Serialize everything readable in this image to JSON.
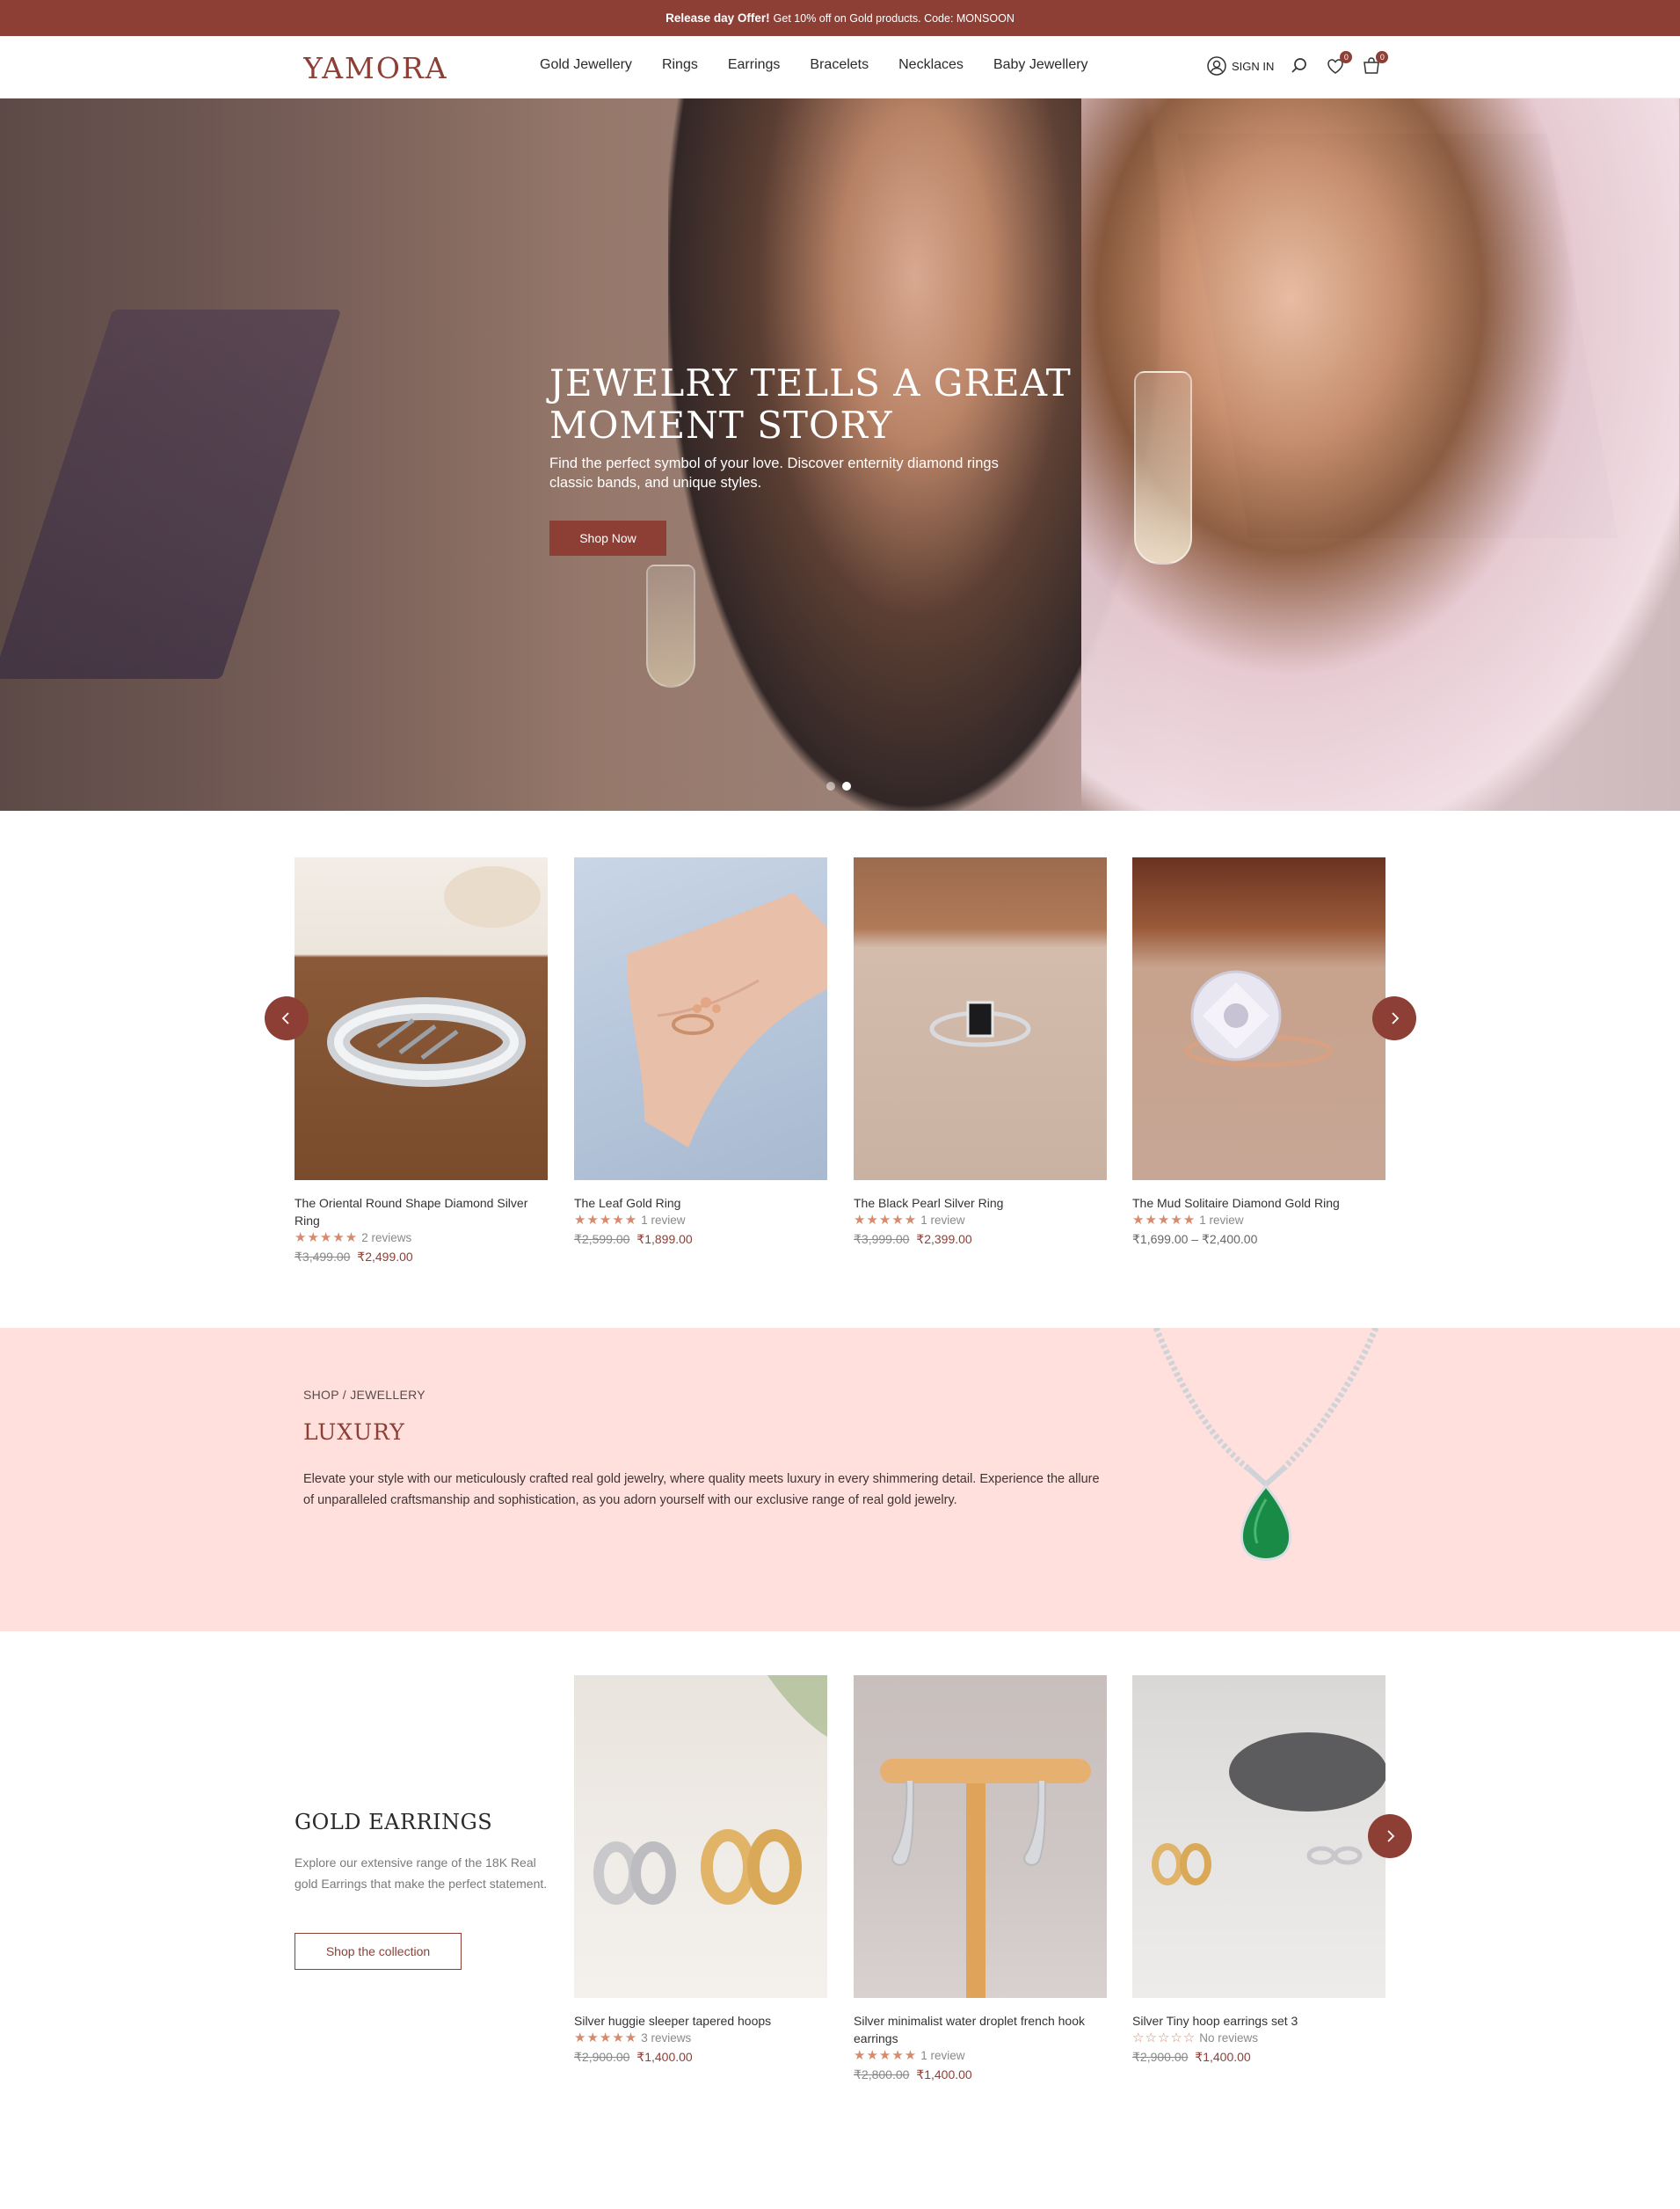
{
  "announcement": {
    "title": "Release day Offer!",
    "text": "Get 10% off on Gold products. Code: MONSOON"
  },
  "header": {
    "logo": "YAMORA",
    "nav": [
      "Gold Jewellery",
      "Rings",
      "Earrings",
      "Bracelets",
      "Necklaces",
      "Baby Jewellery"
    ],
    "sign_in": "SIGN IN",
    "wishlist_count": "0",
    "cart_count": "0"
  },
  "hero": {
    "title": "JEWELRY TELLS A GREAT MOMENT STORY",
    "subtitle": "Find the perfect symbol of your love. Discover enternity diamond rings classic bands, and unique styles.",
    "button": "Shop Now",
    "slides": 2,
    "active_slide": 2
  },
  "rings": [
    {
      "name": "The Oriental Round Shape Diamond Silver Ring",
      "stars": "★★★★★",
      "reviews": "2 reviews",
      "old_price": "₹3,499.00",
      "price": "₹2,499.00"
    },
    {
      "name": "The Leaf Gold Ring",
      "stars": "★★★★★",
      "reviews": "1 review",
      "old_price": "₹2,599.00",
      "price": "₹1,899.00"
    },
    {
      "name": "The Black Pearl Silver Ring",
      "stars": "★★★★★",
      "reviews": "1 review",
      "old_price": "₹3,999.00",
      "price": "₹2,399.00"
    },
    {
      "name": "The Mud Solitaire Diamond Gold Ring",
      "stars": "★★★★★",
      "reviews": "1 review",
      "price_range": "₹1,699.00 – ₹2,400.00"
    }
  ],
  "luxury": {
    "breadcrumb": "SHOP / JEWELLERY",
    "title": "LUXURY",
    "text": "Elevate your style with our meticulously crafted real gold jewelry, where quality meets luxury in every shimmering detail. Experience the allure of unparalleled craftsmanship and sophistication, as you adorn yourself with our exclusive range of real gold jewelry."
  },
  "earrings_section": {
    "title": "GOLD EARRINGS",
    "text": "Explore our extensive range of the 18K Real gold Earrings that make the perfect statement.",
    "button": "Shop the collection"
  },
  "earrings": [
    {
      "name": "Silver huggie sleeper tapered hoops",
      "stars": "★★★★★",
      "reviews": "3 reviews",
      "old_price": "₹2,900.00",
      "price": "₹1,400.00"
    },
    {
      "name": "Silver minimalist water droplet french hook earrings",
      "stars": "★★★★★",
      "reviews": "1 review",
      "old_price": "₹2,800.00",
      "price": "₹1,400.00"
    },
    {
      "name": "Silver Tiny hoop earrings set 3",
      "stars": "☆☆☆☆☆",
      "reviews": "No reviews",
      "old_price": "₹2,900.00",
      "price": "₹1,400.00"
    }
  ],
  "colors": {
    "brand": "#8e3f35",
    "luxury_bg": "#ffe0dd",
    "star": "#d88a6c"
  }
}
